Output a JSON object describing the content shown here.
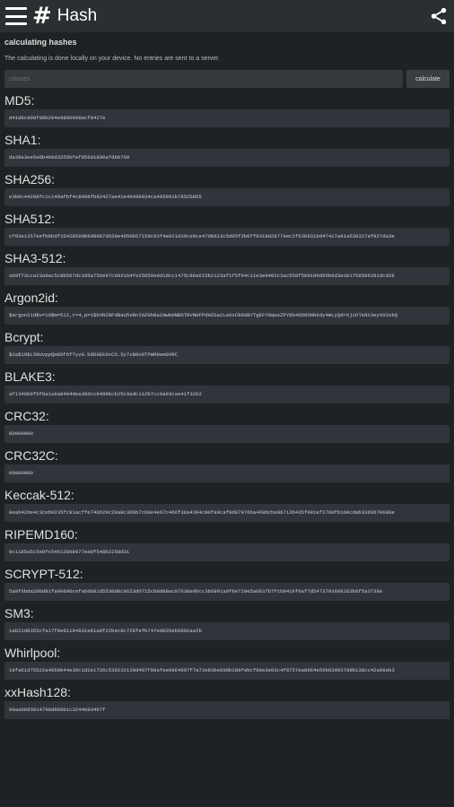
{
  "appbar": {
    "title": "Hash",
    "logo": "#"
  },
  "intro": {
    "heading": "calculating hashes",
    "description": "The calculating is done locally on your device. No entries are sent to a server.",
    "input_placeholder": "classes",
    "calculate_label": "calculate"
  },
  "hashes": [
    {
      "label": "MD5:",
      "value": "d41d8cd98f00b204e9800998ecf8427e"
    },
    {
      "label": "SHA1:",
      "value": "da39a3ee5e6b4b0d3255bfef95601890afd80709"
    },
    {
      "label": "SHA256:",
      "value": "e3b0c44298fc1c149afbf4c8996fb92427ae41e4649b934ca495991b7852b855"
    },
    {
      "label": "SHA512:",
      "value": "cf83e1357eefb8bdf1542850d66d8007d620e4050b5715dc83f4a921d36ce9ce47d0d13c5d85f2b0ff8318d2877eec2f63b931bd47417a81a538327af927da3e"
    },
    {
      "label": "SHA3-512:",
      "value": "a69f73cca23a9ac5c8b567dc185a756e97c982164fe25859e0d1dcc1475c80a615b2123af1f5f94c11e3e9402c3ac558f500199d95b6d3e301758586281dcd26"
    },
    {
      "label": "Argon2id:",
      "value": "$argon2id$v=19$m=512,t=4,p=1$bVRZNFdBaU5sRnI0ZGhBa1NwbHNBOTBVNHFPdHZGa2Le0xCB6GBYTgEFY0qwsZPY8b40D9ONNkdy4mLyQdrKjzDlkNX3eyXO3sbQ"
    },
    {
      "label": "Bcrypt:",
      "value": "$2a$10$L5NUvppQm6Df6fTyzG.b8D9Ek0xCO.5y7zB0o9TPWM0em0VRC"
    },
    {
      "label": "BLAKE3:",
      "value": "af1349b9f5f9a1a6a0404dea36dcc9499bcb25c9adc112b7cc9a93cae41f3262"
    },
    {
      "label": "CRC32:",
      "value": "00000000"
    },
    {
      "label": "CRC32C:",
      "value": "00000000"
    },
    {
      "label": "Keccak-512:",
      "value": "0eab42de4c3ceb9235fc91acffe746b29c29a8c366b7c60e4e67c466f36a4304c00fa9caf9d87976ba469bcbe06713b435f091ef2769fb160cdab33d3670680e"
    },
    {
      "label": "RIPEMD160:",
      "value": "9c1185a5c5e9fc54612808977ee8f548b2258d31"
    },
    {
      "label": "SCRYPT-512:",
      "value": "5a0f6bda20bd81fa00690cefa6d881d5530d0c8623d0715cb8d89ac97630e9bcc3b6991a9f6e728e5a0637b7fcb8416f0af7d5473793608263b6f5a3738e"
    },
    {
      "label": "SM3:",
      "value": "1ab21d8355cfa17f8e61194831e81a8f22bec8c728fefb747ed035eb5082aa2b"
    },
    {
      "label": "Whirlpool:",
      "value": "19fa61d75522a4669b44e39c1d2e1726c530232130d407f89afee0964997f7a73e83be698b288febcf88e3e03c4f0757ea8964e59b63d93708b138cc42a66eb3"
    },
    {
      "label": "xxHash128:",
      "value": "99aa06d3014798d86001c324468d497f"
    }
  ]
}
